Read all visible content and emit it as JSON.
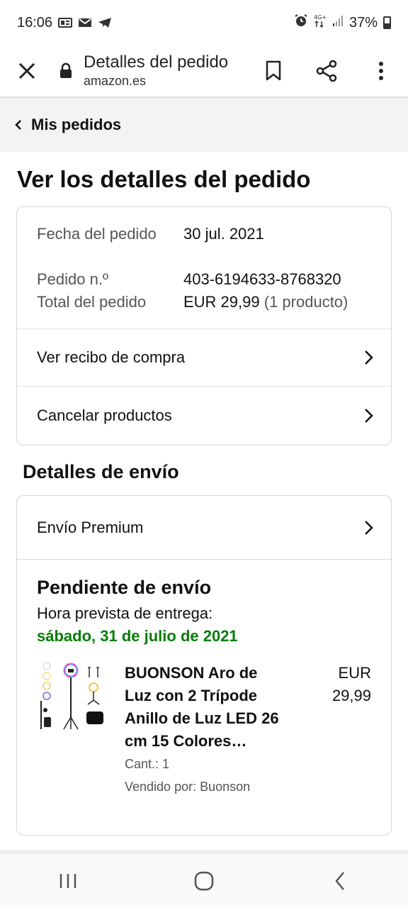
{
  "status_bar": {
    "time": "16:06",
    "battery": "37%",
    "notification_icons": [
      "news-icon",
      "mail-icon",
      "telegram-icon"
    ],
    "system_icons": [
      "alarm-icon",
      "4g-icon",
      "signal-icon",
      "battery-icon"
    ]
  },
  "browser": {
    "title": "Detalles del pedido",
    "host": "amazon.es"
  },
  "back_nav": {
    "label": "Mis pedidos"
  },
  "page": {
    "title": "Ver los detalles del pedido"
  },
  "order_summary": {
    "rows": [
      {
        "label": "Fecha del pedido",
        "value": "30 jul. 2021"
      },
      {
        "label": "Pedido n.º",
        "value": "403-6194633-8768320"
      },
      {
        "label": "Total del pedido",
        "value": "EUR 29,99",
        "extra": "(1 producto)"
      }
    ],
    "links": [
      "Ver recibo de compra",
      "Cancelar productos"
    ]
  },
  "shipping": {
    "section_title": "Detalles de envío",
    "method": "Envío Premium",
    "status": "Pendiente de envío",
    "eta_label": "Hora prevista de entrega:",
    "eta_date": "sábado, 31 de julio de 2021",
    "product": {
      "title": "BUONSON Aro de Luz con 2 Trípode Anillo de Luz LED 26 cm 15 Colores…",
      "qty": "Cant.: 1",
      "seller": "Vendido por: Buonson",
      "price_currency": "EUR",
      "price_value": "29,99"
    }
  },
  "colors": {
    "accent_green": "#067d06",
    "border": "#d5d9d9",
    "back_bar_bg": "#f3f3f3"
  }
}
